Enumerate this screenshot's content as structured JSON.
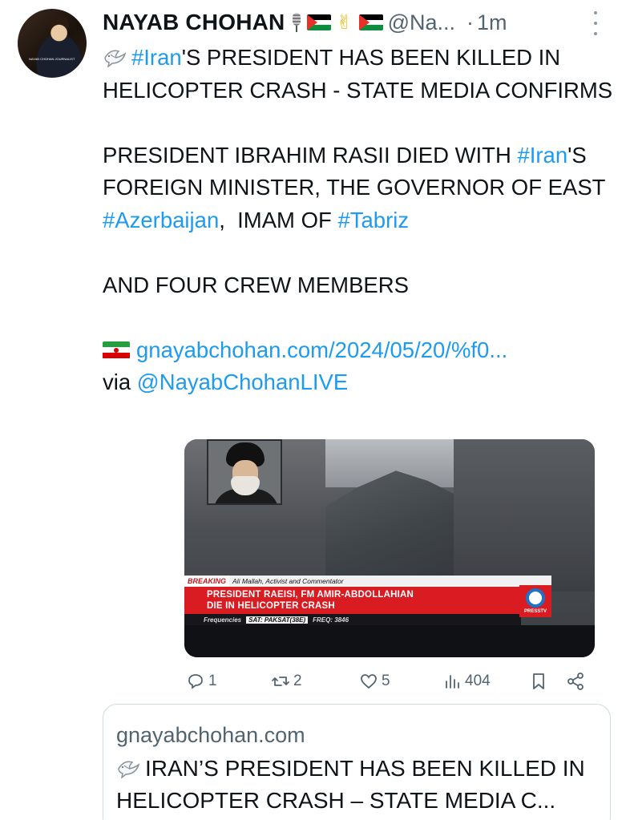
{
  "author": {
    "display_name": "NAYAB CHOHAN",
    "handle": "@Na...",
    "timestamp": "1m",
    "separator": "·",
    "avatar_caption": "NAYAB CHOHAN JOURNALIST"
  },
  "tweet": {
    "line1_tag": "#Iran",
    "line1_rest": "'S PRESIDENT HAS BEEN KILLED IN HELICOPTER CRASH - STATE MEDIA CONFIRMS",
    "para2_a": "PRESIDENT IBRAHIM RASII DIED WITH ",
    "para2_tag1": "#Iran",
    "para2_b": "'S FOREIGN MINISTER, THE GOVERNOR OF EAST ",
    "para2_tag2": "#Azerbaijan",
    "para2_c": ",  IMAM OF ",
    "para2_tag3": "#Tabriz",
    "para3": "AND FOUR CREW MEMBERS",
    "link": "gnayabchohan.com/2024/05/20/%f0...",
    "via_label": "via ",
    "via_handle": "@NayabChohanLIVE"
  },
  "media": {
    "breaking_label": "BREAKING",
    "guest": "Ali Mallah, Activist and Commentator",
    "headline_1": "PRESIDENT RAEISI, FM AMIR-ABDOLLAHIAN",
    "headline_2": "DIE IN HELICOPTER CRASH",
    "freq_label": "Frequencies",
    "sat": "SAT: PAKSAT(38E)",
    "freq": "FREQ: 3846",
    "channel": "PRESSTV"
  },
  "actions": {
    "replies": "1",
    "retweets": "2",
    "likes": "5",
    "views": "404"
  },
  "card": {
    "domain": "gnayabchohan.com",
    "title": "IRAN’S PRESIDENT HAS BEEN KILLED IN HELICOPTER CRASH – STATE MEDIA C..."
  },
  "colors": {
    "link_blue": "#1d9bf0",
    "muted_gray": "#536471",
    "breaking_red": "#d81c22"
  }
}
